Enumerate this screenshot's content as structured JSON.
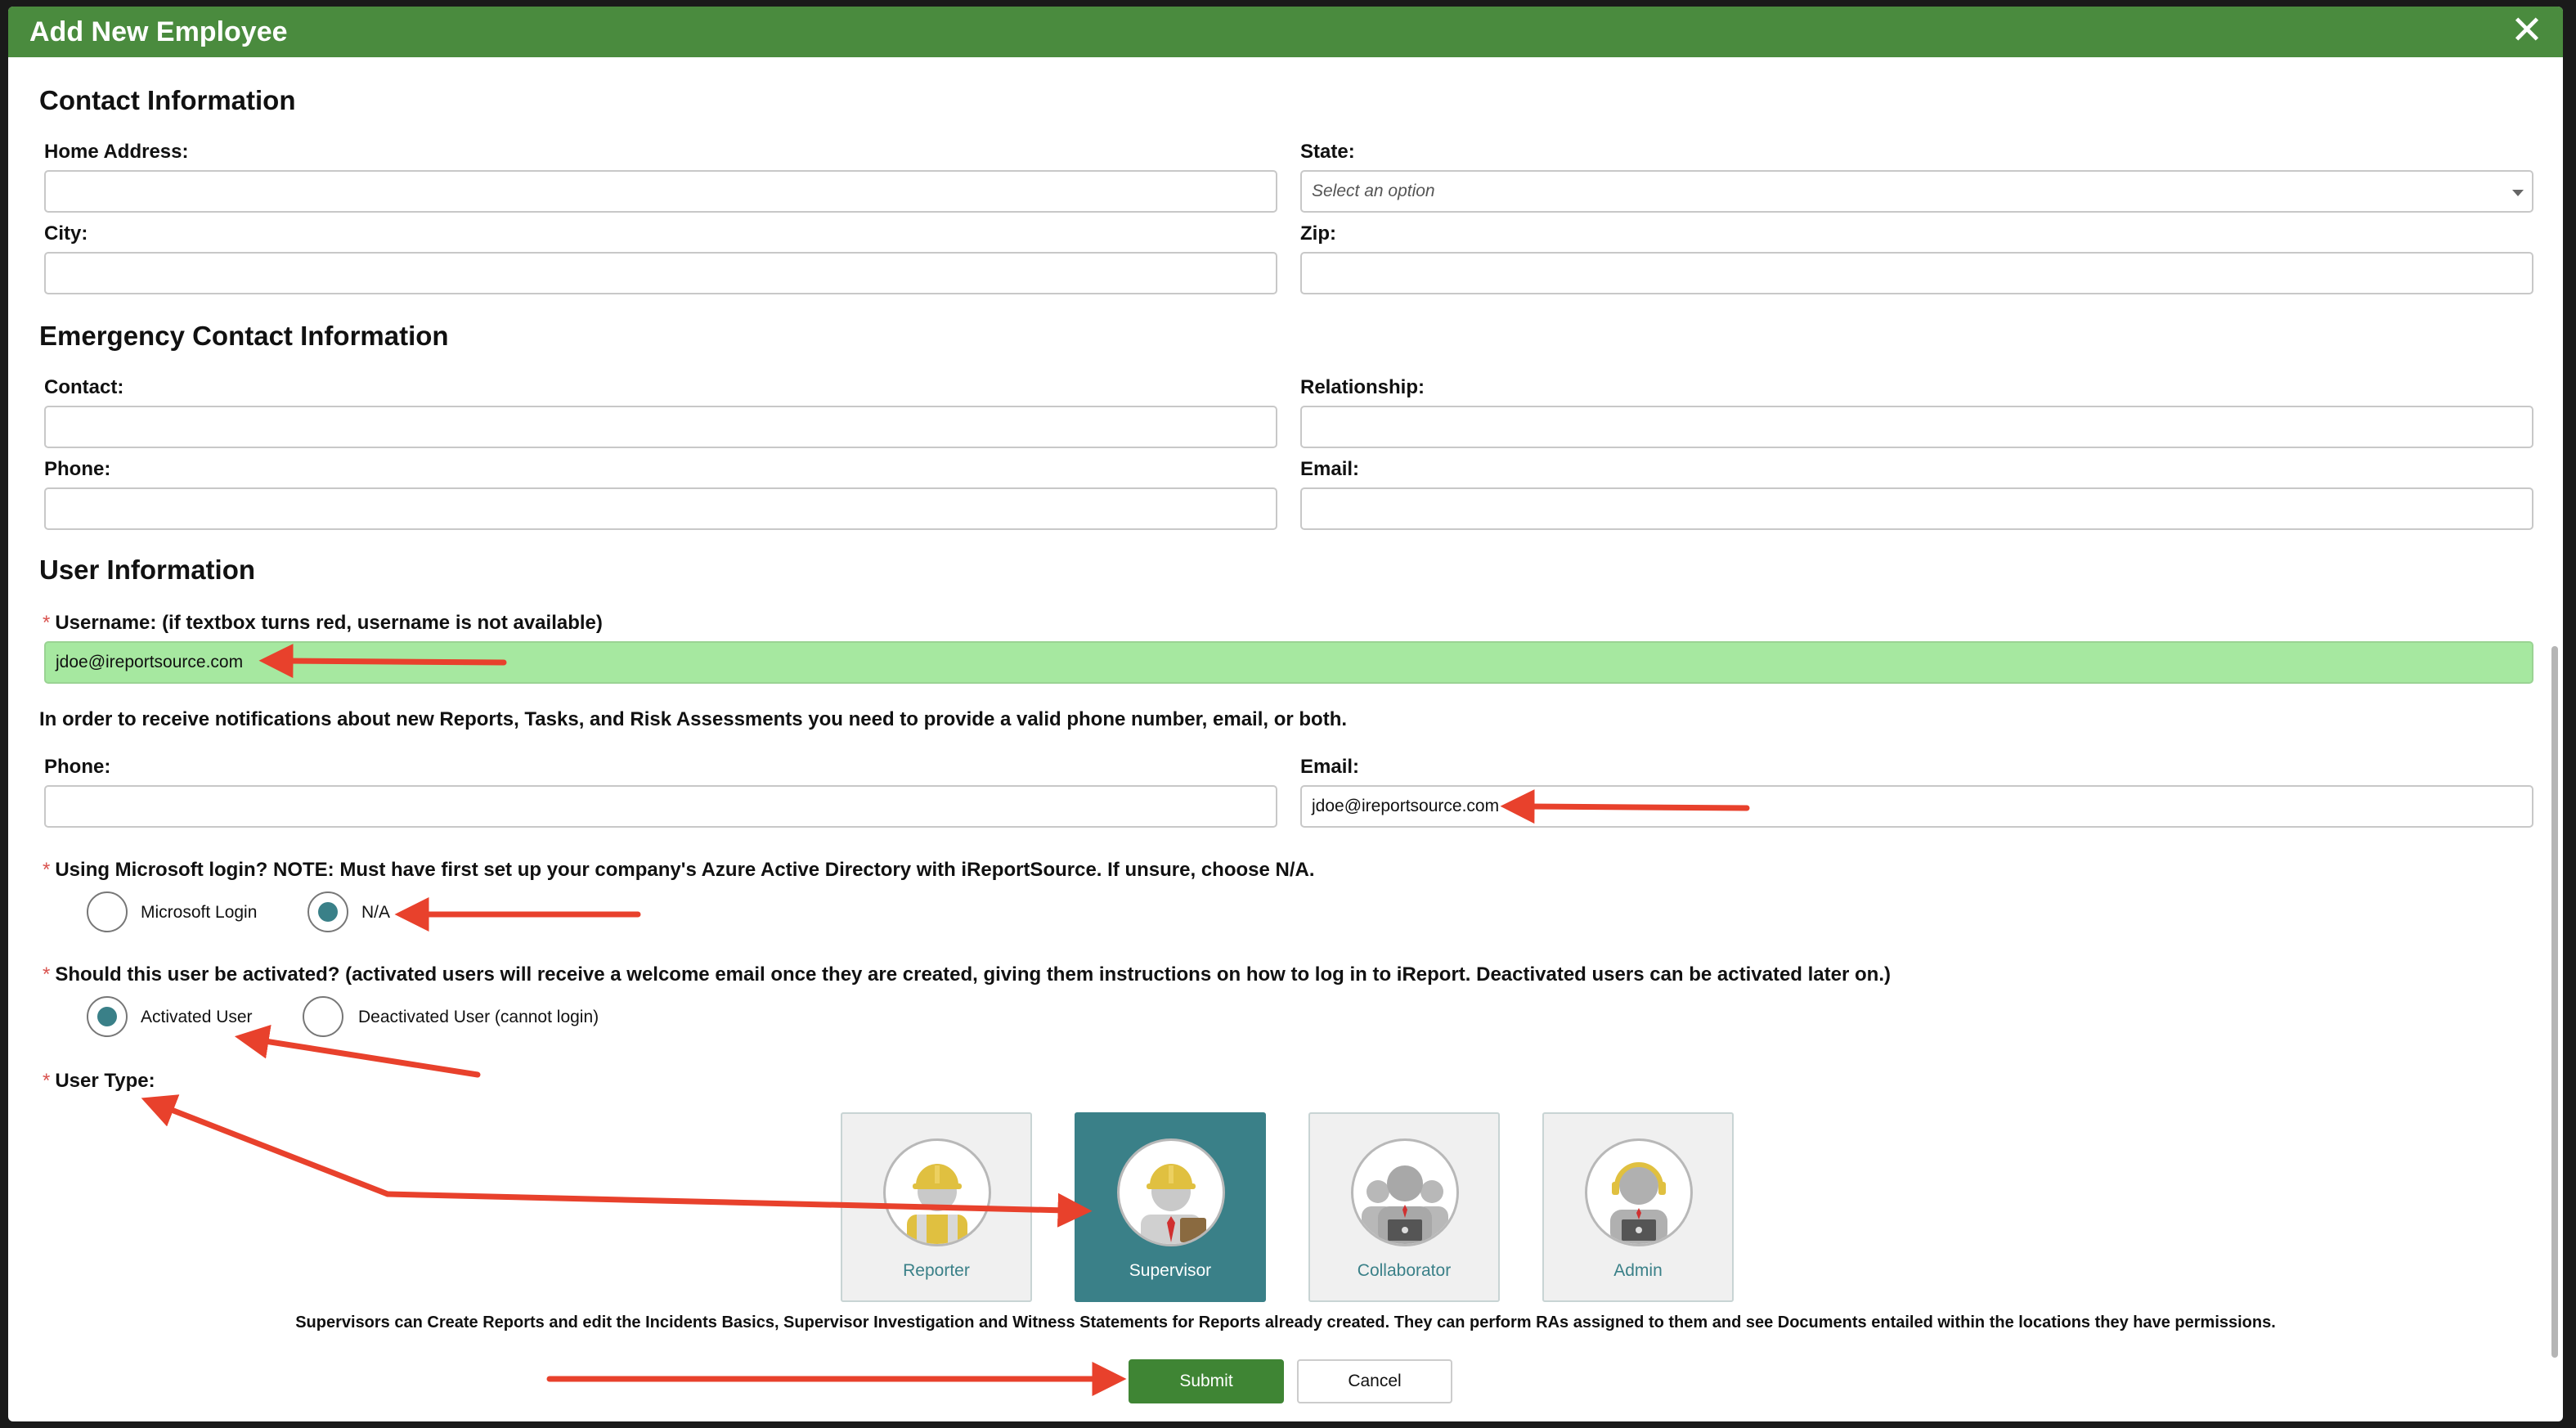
{
  "dialog": {
    "title": "Add New Employee"
  },
  "sections": {
    "contact": "Contact Information",
    "emergency": "Emergency Contact Information",
    "user": "User Information"
  },
  "contact": {
    "home_address_label": "Home Address:",
    "home_address_value": "",
    "state_label": "State:",
    "state_placeholder": "Select an option",
    "city_label": "City:",
    "city_value": "",
    "zip_label": "Zip:",
    "zip_value": ""
  },
  "emergency": {
    "contact_label": "Contact:",
    "relationship_label": "Relationship:",
    "phone_label": "Phone:",
    "email_label": "Email:"
  },
  "user": {
    "username_label": "Username: (if textbox turns red, username is not available)",
    "username_value": "jdoe@ireportsource.com",
    "notification_note": "In order to receive notifications about new Reports, Tasks, and Risk Assessments you need to provide a valid phone number, email, or both.",
    "phone_label": "Phone:",
    "phone_value": "",
    "email_label": "Email:",
    "email_value": "jdoe@ireportsource.com",
    "ms_login_label": "Using Microsoft login? NOTE: Must have first set up your company's Azure Active Directory with iReportSource. If unsure, choose N/A.",
    "ms_login_options": [
      "Microsoft Login",
      "N/A"
    ],
    "ms_login_selected": "N/A",
    "activate_label": "Should this user be activated? (activated users will receive a welcome email once they are created, giving them instructions on how to log in to iReport. Deactivated users can be activated later on.)",
    "activate_options": [
      "Activated User",
      "Deactivated User (cannot login)"
    ],
    "activate_selected": "Activated User",
    "user_type_label": "User Type:",
    "user_types": [
      "Reporter",
      "Supervisor",
      "Collaborator",
      "Admin"
    ],
    "user_type_selected": "Supervisor",
    "user_type_description": "Supervisors can Create Reports and edit the Incidents Basics, Supervisor Investigation and Witness Statements for Reports already created. They can perform RAs assigned to them and see Documents entailed within the locations they have permissions."
  },
  "buttons": {
    "submit": "Submit",
    "cancel": "Cancel"
  },
  "required_marker": "*",
  "colors": {
    "header": "#4a8b3e",
    "username_ok": "#a6e8a0",
    "selected_card": "#3a8088",
    "submit": "#3f8534",
    "annotation_arrow": "#e8412c"
  },
  "icons": {
    "close": "close-icon",
    "dropdown": "chevron-down-icon",
    "reporter": "hardhat-worker-icon",
    "supervisor": "hardhat-supervisor-icon",
    "collaborator": "collaborator-group-icon",
    "admin": "headset-admin-icon"
  }
}
